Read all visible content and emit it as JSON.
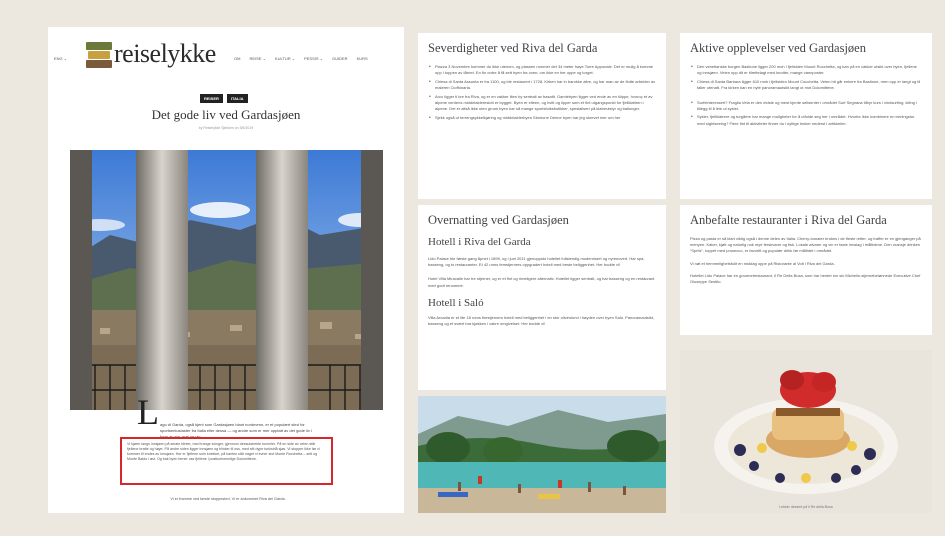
{
  "blog": {
    "lang": "ENG ⌄",
    "logo_text": "reiselykke",
    "nav": [
      "OM",
      "REISE ⌄",
      "KULTUR ⌄",
      "PESSIS ⌄",
      "GUIDER",
      "KURS"
    ],
    "tags": [
      "REISER",
      "ITALIA"
    ],
    "title": "Det gode liv ved Gardasjøen",
    "byline": "by Reiselykke Sjekken on 5/5/2019",
    "dropcap": "L",
    "intro": "ago di Garda, også kjent som Gardasjøen blant nordmenn, er et populært sted for sportsentusiaster fra Italia eller dessa — og andre som er mer opptatt av det gode liv i form av sjø, mat og vin.",
    "highlight": "Vi kjører langs innsjøen på smale klinter, med trange svinger, gjennom dessutstrekte tunneler. På en side av veien står fjellene bratte og høye. På andre siden ligger innsjøen og blinker til oss, med sitt dype turkisblå sjøs. Vi stopper ikke før vi kommer til endes av innsjøen. Her er fjellene som knekket, på kanten står naget vi evner slot Monte Rocchetta – sett og Monte Baldo i øst. Og bak byen ferner oss fjellene i postkortvennlige Dolomittene.",
    "after": "Vi er framme ved første stoppested. Vi er ankommet Riva del Garda."
  },
  "sev": {
    "title": "Severdigheter ved Riva del Garda",
    "items": [
      "Piazza 3 Novembre kommer du ikke utenom, og plassen rommer det 34 meter høye Torre Apponale. Det er mulig å komme opp i toppen av tårnet. En fin ordre å få sett byen fra oven, om ikke en her oppe og torget.",
      "Chiesa di Santa Assunta er fra 1100, og ble restaurert i 1728. Kirken har in barokke altre, og har man av de flotte arbeider av maleren Cioffonaria.",
      "Arco ligger ti kre fra Riva, og er en vakker liten by sentralt av basaltt. Gamlebyen ligger ved ende av en klippe, hvoroç et av alpene verdens middelaldereslott er bygget. Byen er elleen, og hvitt og lipper som et fint utgangspunkt for fjellklattren i alpene. Det er altså ikke uten grunn byen har så mange sportsfolksbutikker, spesialisert på klatreutstyr og ballonger.",
      "Sjekk også ut terrengsykkelkjøring og middelalderbyen Sirmione Denne byen har jeg skrevet mer om her"
    ]
  },
  "akt": {
    "title": "Aktive opplevelser ved Gardasjøen",
    "items": [
      "Den venetianske borgen Bastione ligger 200 moh i fjellsiden Mount Rocchetta, og kan på en vakker utsikt over byen, fjellene og innsjøen. Veien opp dit er tilrettelagt med knotter, mange vannposter.",
      "Chiesa di Santa Barbara ligger 610 moh i fjellsiden Mount Cocchetta. Veien hit går enkere fra Bastione, men opp er langt og til faller utenatt. Fra kirken kan en nyte panoramautsikt langt ut mot Dolomittene.",
      "Surfeinteressert? Fraglia Vela er den eldste og mest kjente seilsenter i området Surf Segnana tilbyr kurs i vindsurfing, kiting i tillegg til å leie ut sykler.",
      "Sykler, fjellklatrere og turgåere har mange muligheter for å utfolde seg her i området. Hvorfor ikke kombinere en treningstur med sightseeing? Flere fint til aktiviteter finner du i nyttige lenker nederst i artikkelen."
    ]
  },
  "ove": {
    "title": "Overnatting ved Gardasjøen",
    "sub1": "Hotell i Riva del Garda",
    "p1": "Lido Palace ble første gang åpnet i 1899, og i juni 2011 gjenoppsto hotellet fullstendig modernisert og nyrenovert. Har spa, basseng, og to restauranter. Et 42 roms femstjerners oppgradert hotell med beste beliggenhet. Her bodde vi!",
    "p2": "Hotel Villa Miravalle har tre stjerner, og er et fint og rimeligere alternativ. Hotellet ligger sentralt, og har basseng og en restaurant med godt renommé.",
    "sub2": "Hotell i Saló",
    "p3": "Villa Arcadia er et lite 18 roms firestjerners hotell med beliggenhet i en stor olivenlund i høyden over byen Saló. Panoramautsikt, basseng og et svært bra kjøkken i vakre omgivelser. Her bodde vi!"
  },
  "anb": {
    "title": "Anbefalte restauranter i Riva del Garda",
    "p1": "Pizza og pasta er så klart viktig også i denne delen av Italia. Cherry-tomater brukes i de fleste retter, og traffer er en gjenganger på menyen. Kaker, kjøtt og naturlig nok mye ferskvarer og fisk. Lokale ølvarer og vin er faste innslag i måltidene. Den oransje drinken “Spritz”, toppet med prosecco, er favoritt og populær drikk før måltidet i området.",
    "p2": "Vi nøt et hemmelighetsfullt en middag oppe på Ristorante al Volt i Riva del Garda.",
    "p3": "Hotellet Lido Palace har en gourmetrestaurant, Il Re Della Busa, som har hentet inn sin Michelin-stjernebelønnede Executive Chef Giuseppe Sestito."
  },
  "dessert": {
    "caption": "Lekker dessert på Il Re della Busa"
  }
}
